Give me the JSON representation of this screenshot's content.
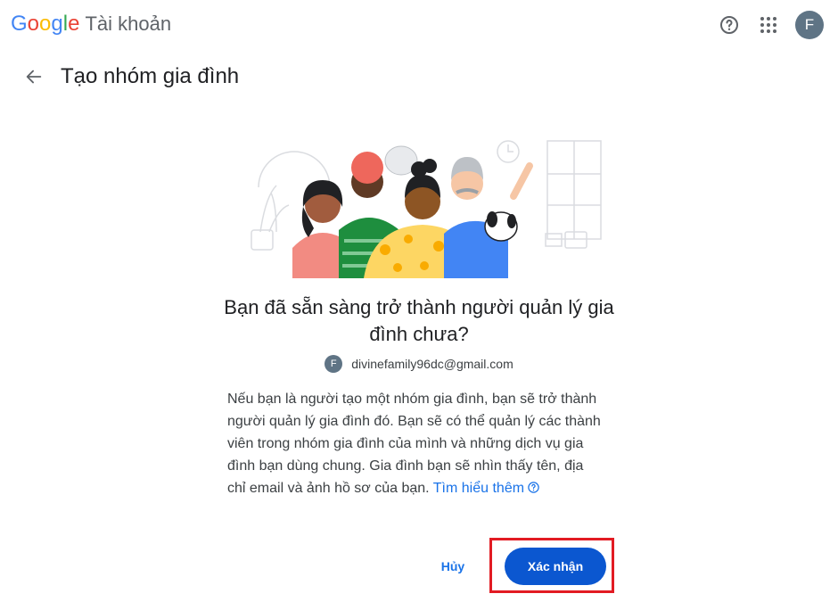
{
  "header": {
    "logo_word": "Google",
    "product": "Tài khoản",
    "help_icon": "help-circle-icon",
    "apps_icon": "apps-grid-icon",
    "avatar_letter": "F"
  },
  "page": {
    "back_icon": "arrow-left-icon",
    "title": "Tạo nhóm gia đình"
  },
  "content": {
    "heading": "Bạn đã sẵn sàng trở thành người quản lý gia đình chưa?",
    "account_avatar": "F",
    "account_email": "divinefamily96dc@gmail.com",
    "body": "Nếu bạn là người tạo một nhóm gia đình, bạn sẽ trở thành người quản lý gia đình đó. Bạn sẽ có thể quản lý các thành viên trong nhóm gia đình của mình và những dịch vụ gia đình bạn dùng chung. Gia đình bạn sẽ nhìn thấy tên, địa chỉ email và ảnh hồ sơ của bạn.",
    "learn_more": "Tìm hiểu thêm"
  },
  "actions": {
    "cancel_label": "Hủy",
    "confirm_label": "Xác nhận"
  },
  "colors": {
    "accent": "#0b57d0",
    "link": "#1a73e8",
    "highlight": "#e21b23"
  }
}
